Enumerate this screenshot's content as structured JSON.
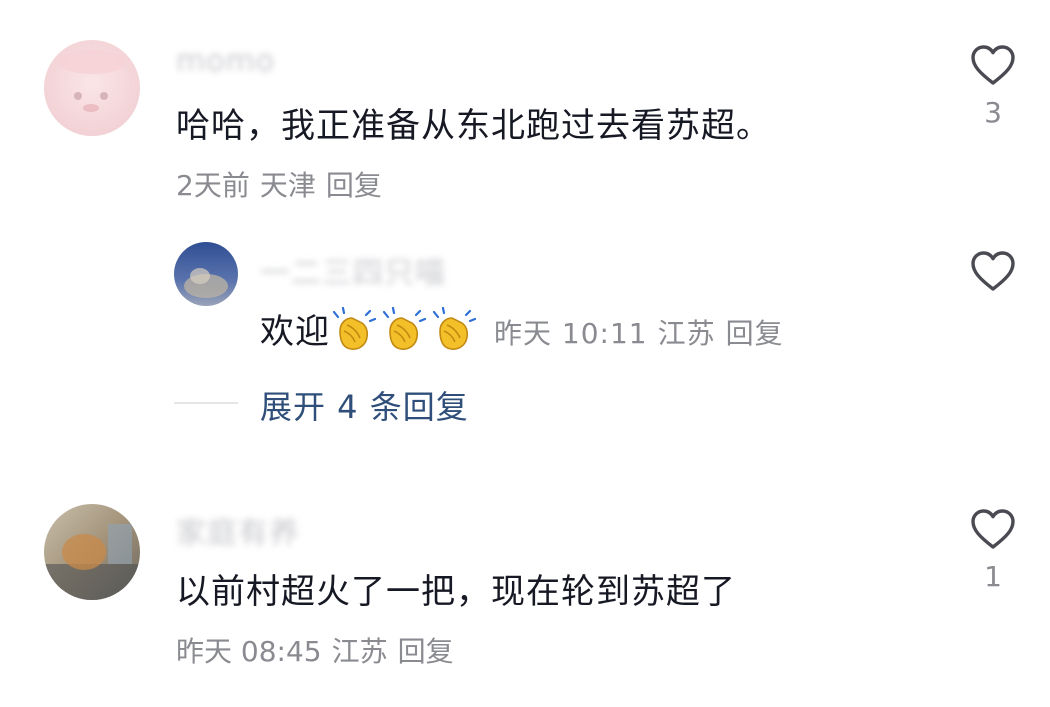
{
  "comments": [
    {
      "username": "momo",
      "text": "哈哈，我正准备从东北跑过去看苏超。",
      "time": "2天前",
      "location": "天津",
      "reply_label": "回复",
      "like_count": "3",
      "replies": [
        {
          "username": "一二三四只喵",
          "text": "欢迎",
          "emoji": "clapping-hands-icon",
          "emoji_count": 3,
          "time": "昨天 10:11",
          "location": "江苏",
          "reply_label": "回复",
          "like_count": ""
        }
      ],
      "expand_label": "展开 4 条回复"
    },
    {
      "username": "家庭有养",
      "text": "以前村超火了一把，现在轮到苏超了",
      "time": "昨天 08:45",
      "location": "江苏",
      "reply_label": "回复",
      "like_count": "1"
    }
  ],
  "colors": {
    "text": "#161823",
    "meta": "#8a8b91",
    "expand_link": "#2f4f7a",
    "heart_stroke": "#4a4b52"
  }
}
